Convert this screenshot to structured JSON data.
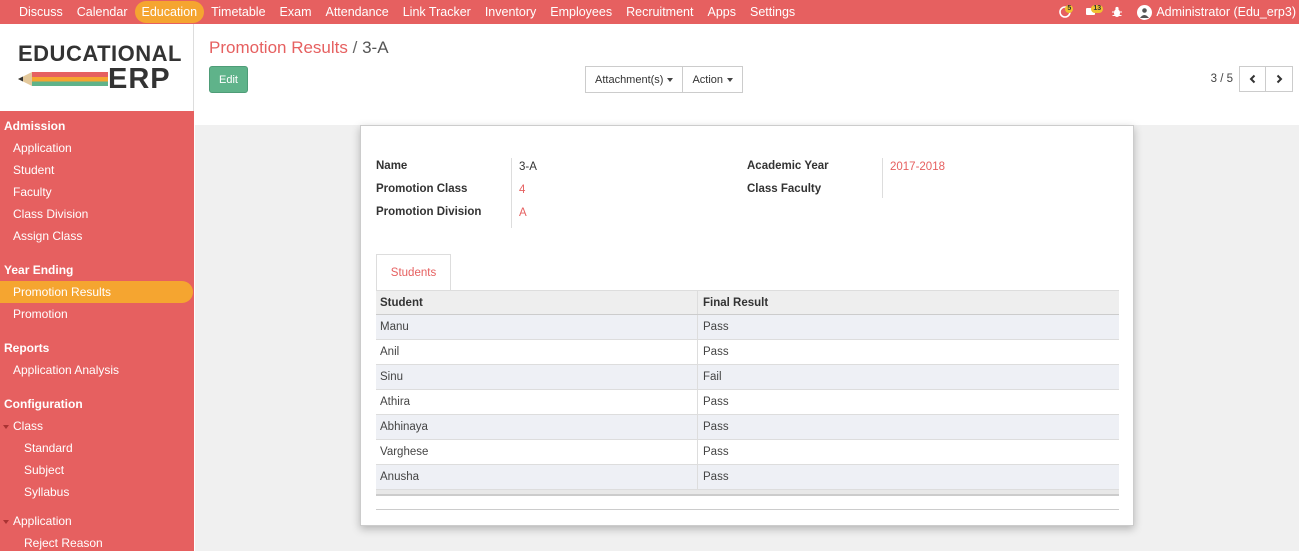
{
  "topnav": {
    "items": [
      "Discuss",
      "Calendar",
      "Education",
      "Timetable",
      "Exam",
      "Attendance",
      "Link Tracker",
      "Inventory",
      "Employees",
      "Recruitment",
      "Apps",
      "Settings"
    ],
    "active": "Education",
    "chat_count": "5",
    "activity_count": "13",
    "user": "Administrator (Edu_erp3)"
  },
  "logo": {
    "top": "EDUCATIONAL",
    "bottom": "ERP"
  },
  "sidebar": {
    "sections": [
      {
        "title": "Admission",
        "items": [
          {
            "label": "Application",
            "level": 1
          },
          {
            "label": "Student",
            "level": 1
          },
          {
            "label": "Faculty",
            "level": 1
          },
          {
            "label": "Class Division",
            "level": 1
          },
          {
            "label": "Assign Class",
            "level": 1
          }
        ]
      },
      {
        "title": "Year Ending",
        "items": [
          {
            "label": "Promotion Results",
            "level": 1,
            "active": true
          },
          {
            "label": "Promotion",
            "level": 1
          }
        ]
      },
      {
        "title": "Reports",
        "items": [
          {
            "label": "Application Analysis",
            "level": 1
          }
        ]
      },
      {
        "title": "Configuration",
        "items": [
          {
            "label": "Class",
            "level": 1,
            "caret": true
          },
          {
            "label": "Standard",
            "level": 2
          },
          {
            "label": "Subject",
            "level": 2
          },
          {
            "label": "Syllabus",
            "level": 2
          },
          {
            "label": "Application",
            "level": 1,
            "caret": true,
            "gap": true
          },
          {
            "label": "Reject Reason",
            "level": 2
          }
        ]
      }
    ]
  },
  "breadcrumb": {
    "parent": "Promotion Results",
    "separator": "/",
    "current": "3-A"
  },
  "buttons": {
    "edit": "Edit",
    "attachments": "Attachment(s)",
    "action": "Action"
  },
  "pager": {
    "value": "3 / 5"
  },
  "form": {
    "name_label": "Name",
    "name": "3-A",
    "promotion_class_label": "Promotion Class",
    "promotion_class": "4",
    "promotion_division_label": "Promotion Division",
    "promotion_division": "A",
    "academic_year_label": "Academic Year",
    "academic_year": "2017-2018",
    "class_faculty_label": "Class Faculty",
    "class_faculty": ""
  },
  "tab": {
    "label": "Students"
  },
  "table": {
    "headers": [
      "Student",
      "Final Result"
    ],
    "rows": [
      [
        "Manu",
        "Pass"
      ],
      [
        "Anil",
        "Pass"
      ],
      [
        "Sinu",
        "Fail"
      ],
      [
        "Athira",
        "Pass"
      ],
      [
        "Abhinaya",
        "Pass"
      ],
      [
        "Varghese",
        "Pass"
      ],
      [
        "Anusha",
        "Pass"
      ]
    ]
  },
  "colors": {
    "primary": "#e66060",
    "accent": "#f5a530",
    "edit_button": "#5fb38a"
  }
}
